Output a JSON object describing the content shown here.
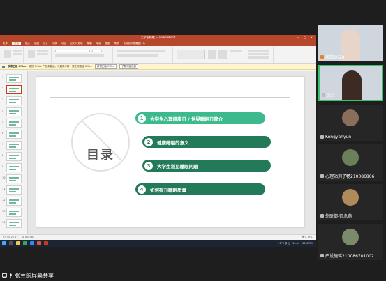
{
  "ppt": {
    "doc_title": "大学生睡眠 — PowerPoint",
    "window_controls": [
      "—",
      "▢",
      "✕"
    ],
    "menus": [
      "文件",
      "开始",
      "插入",
      "绘图",
      "设计",
      "切换",
      "动画",
      "幻灯片放映",
      "录制",
      "审阅",
      "视图",
      "帮助",
      "告诉我你想要做什么"
    ],
    "active_menu_index": 1,
    "infobar_label": "获得正版 Office",
    "infobar_msg": "你的 Office 产品未激活。为避免中断，请立即激活 Office",
    "infobar_btn1": "获得正版 Office",
    "infobar_btn2": "了解详细信息",
    "status_left": "幻灯片 2 / 17",
    "status_lang": "中文(中国)",
    "status_right": "备注   批注"
  },
  "slide": {
    "heading": "目录",
    "items": [
      {
        "num": "1",
        "text": "大学生心理健康日 / 世界睡眠日简介",
        "color": "#3dba8d"
      },
      {
        "num": "2",
        "text": "健康睡眠的意义",
        "color": "#237a58"
      },
      {
        "num": "3",
        "text": "大学生常见睡眠问题",
        "color": "#237a58"
      },
      {
        "num": "4",
        "text": "如何提升睡眠质量",
        "color": "#237a58"
      }
    ]
  },
  "thumbnails": [
    "1",
    "2",
    "3",
    "4",
    "5",
    "6",
    "7",
    "8",
    "9",
    "10",
    "11",
    "12",
    "13",
    "14"
  ],
  "selected_thumb": 1,
  "taskbar": {
    "weather": "21°C 多云",
    "time": "10:04",
    "date": "2022/3/4"
  },
  "participants": [
    {
      "name": "茜茜2020",
      "video": true,
      "active": false,
      "mic_hot": true
    },
    {
      "name": "张兰",
      "video": true,
      "active": true,
      "mic_hot": false
    },
    {
      "name": "Kongyanyun",
      "video": false,
      "active": false,
      "mic_hot": false
    },
    {
      "name": "心理站刘子畅210086806",
      "video": false,
      "active": false,
      "mic_hot": false
    },
    {
      "name": "外联部-师念燕",
      "video": false,
      "active": false,
      "mic_hot": false
    },
    {
      "name": "产设施瑶210086701002",
      "video": false,
      "active": false,
      "mic_hot": false
    }
  ],
  "footer": {
    "share_label": "张兰的屏幕共享"
  }
}
